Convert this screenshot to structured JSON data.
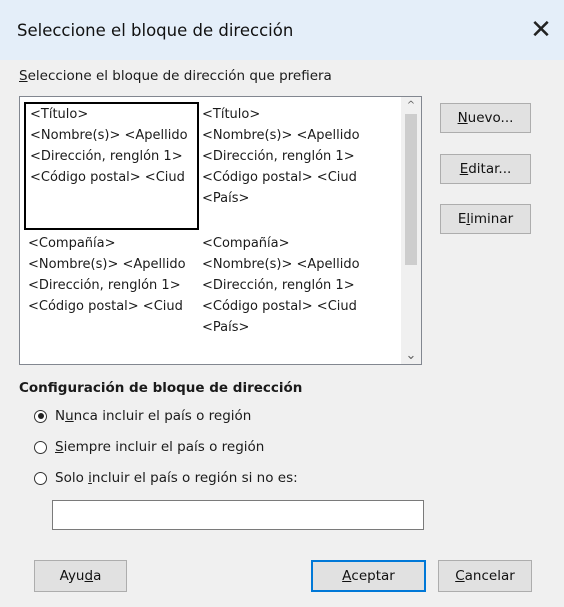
{
  "window": {
    "title": "Seleccione el bloque de dirección",
    "close_glyph": "✕"
  },
  "list_label": "Seleccione el bloque de dirección que prefiera",
  "address_blocks": [
    {
      "lines": [
        "<Título>",
        "<Nombre(s)> <Apellido",
        "<Dirección, renglón 1>",
        "<Código postal> <Ciud"
      ],
      "selected": true
    },
    {
      "lines": [
        "<Título>",
        "<Nombre(s)> <Apellido",
        "<Dirección, renglón 1>",
        "<Código postal> <Ciud",
        "<País>"
      ],
      "selected": false
    },
    {
      "lines": [
        "<Compañía>",
        "<Nombre(s)> <Apellido",
        "<Dirección, renglón 1>",
        "<Código postal> <Ciud"
      ],
      "selected": false
    },
    {
      "lines": [
        "<Compañía>",
        "<Nombre(s)> <Apellido",
        "<Dirección, renglón 1>",
        "<Código postal> <Ciud",
        "<País>"
      ],
      "selected": false
    }
  ],
  "scrollbar": {
    "up_glyph": "^",
    "down_glyph": "⌄"
  },
  "side_buttons": {
    "new": "Nuevo...",
    "edit": "Editar...",
    "delete": "Eliminar"
  },
  "config": {
    "title": "Configuración de bloque de dirección",
    "options": [
      {
        "label": "Nunca incluir el país o región",
        "checked": true
      },
      {
        "label": "Siempre incluir el país o región",
        "checked": false
      },
      {
        "label": "Solo incluir el país o región si no es:",
        "checked": false
      }
    ],
    "country_value": ""
  },
  "footer": {
    "help": "Ayuda",
    "ok": "Aceptar",
    "cancel": "Cancelar"
  }
}
